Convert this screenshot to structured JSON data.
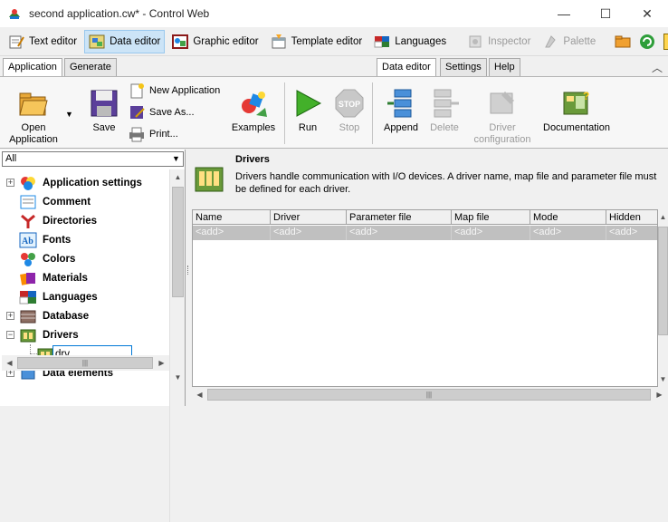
{
  "window": {
    "title": "second application.cw* - Control Web",
    "minimize": "—",
    "maximize": "☐",
    "close": "✕"
  },
  "toolbar": {
    "text_editor": "Text editor",
    "data_editor": "Data editor",
    "graphic_editor": "Graphic editor",
    "template_editor": "Template editor",
    "languages": "Languages",
    "inspector": "Inspector",
    "palette": "Palette",
    "help_glyph": "?"
  },
  "tabs": {
    "application": "Application",
    "generate": "Generate",
    "data_editor": "Data editor",
    "settings": "Settings",
    "help": "Help"
  },
  "ribbon": {
    "open_application": "Open Application",
    "save": "Save",
    "new_application": "New Application",
    "save_as": "Save As...",
    "print": "Print...",
    "examples": "Examples",
    "run": "Run",
    "stop": "Stop",
    "stop_sign": "STOP",
    "append": "Append",
    "delete": "Delete",
    "driver_configuration": "Driver configuration",
    "documentation": "Documentation"
  },
  "left_panel": {
    "filter_value": "All",
    "tree": [
      {
        "label": "Application settings",
        "expandable": true
      },
      {
        "label": "Comment",
        "expandable": false
      },
      {
        "label": "Directories",
        "expandable": false
      },
      {
        "label": "Fonts",
        "expandable": false
      },
      {
        "label": "Colors",
        "expandable": false
      },
      {
        "label": "Materials",
        "expandable": false
      },
      {
        "label": "Languages",
        "expandable": false
      },
      {
        "label": "Database",
        "expandable": true
      },
      {
        "label": "Drivers",
        "expandable": true
      },
      {
        "label": "Data elements",
        "expandable": false
      }
    ],
    "editing_child_value": "drv"
  },
  "right_panel": {
    "title": "Drivers",
    "description": "Drivers handle communication with I/O devices. A driver name, map file and parameter file must be defined for each driver.",
    "columns": [
      "Name",
      "Driver",
      "Parameter file",
      "Map file",
      "Mode",
      "Hidden"
    ],
    "add_row_text": "<add>"
  },
  "colors": {
    "active_tool": "#cce4f7",
    "grid_add_row": "#c0c0c0"
  }
}
